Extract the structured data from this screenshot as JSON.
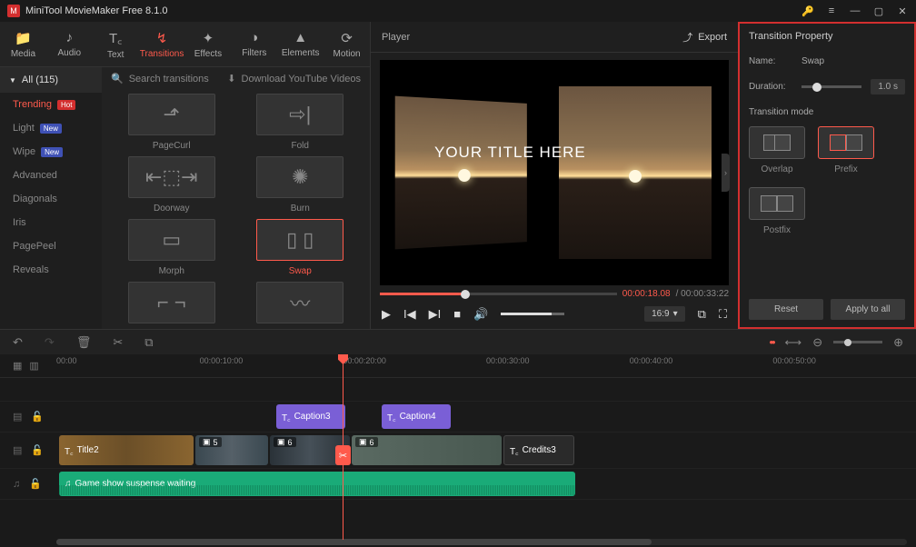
{
  "app": {
    "title": "MiniTool MovieMaker Free 8.1.0"
  },
  "toolTabs": [
    {
      "icon": "📁",
      "label": "Media"
    },
    {
      "icon": "♪",
      "label": "Audio"
    },
    {
      "icon": "T꜀",
      "label": "Text"
    },
    {
      "icon": "↯",
      "label": "Transitions"
    },
    {
      "icon": "✦",
      "label": "Effects"
    },
    {
      "icon": "◑",
      "label": "Filters"
    },
    {
      "icon": "▲",
      "label": "Elements"
    },
    {
      "icon": "⟳",
      "label": "Motion"
    }
  ],
  "categories": {
    "header": "All (115)",
    "items": [
      {
        "label": "Trending",
        "badge": "Hot",
        "badgeClass": "hot",
        "active": true
      },
      {
        "label": "Light",
        "badge": "New",
        "badgeClass": "new"
      },
      {
        "label": "Wipe",
        "badge": "New",
        "badgeClass": "new"
      },
      {
        "label": "Advanced"
      },
      {
        "label": "Diagonals"
      },
      {
        "label": "Iris"
      },
      {
        "label": "PagePeel"
      },
      {
        "label": "Reveals"
      }
    ]
  },
  "thumbToolbar": {
    "search": "Search transitions",
    "download": "Download YouTube Videos"
  },
  "thumbs": [
    {
      "label": "PageCurl",
      "glyph": "⬏"
    },
    {
      "label": "Fold",
      "glyph": "⇨|"
    },
    {
      "label": "Doorway",
      "glyph": "⇤⬚⇥"
    },
    {
      "label": "Burn",
      "glyph": "✺"
    },
    {
      "label": "Morph",
      "glyph": "▭"
    },
    {
      "label": "Swap",
      "glyph": "▯ ▯",
      "selected": true
    },
    {
      "label": "",
      "glyph": "⌐ ¬"
    },
    {
      "label": "",
      "glyph": "〰"
    }
  ],
  "player": {
    "title": "Player",
    "export": "Export",
    "overlay": "YOUR TITLE HERE",
    "current": "00:00:18.08",
    "duration": "00:00:33:22",
    "aspect": "16:9"
  },
  "props": {
    "title": "Transition Property",
    "nameLabel": "Name:",
    "nameValue": "Swap",
    "durLabel": "Duration:",
    "durValue": "1.0 s",
    "modeLabel": "Transition mode",
    "modes": [
      {
        "label": "Overlap"
      },
      {
        "label": "Prefix",
        "selected": true
      },
      {
        "label": "Postfix"
      }
    ],
    "reset": "Reset",
    "applyAll": "Apply to all"
  },
  "ruler": [
    "00:00",
    "00:00:10:00",
    "00:00:20:00",
    "00:00:30:00",
    "00:00:40:00",
    "00:00:50:00"
  ],
  "clips": {
    "caption3": "Caption3",
    "caption4": "Caption4",
    "title2": "Title2",
    "credits3": "Credits3",
    "v2n": "5",
    "v2bn": "6",
    "v3n": "6",
    "audio": "Game show suspense waiting"
  }
}
